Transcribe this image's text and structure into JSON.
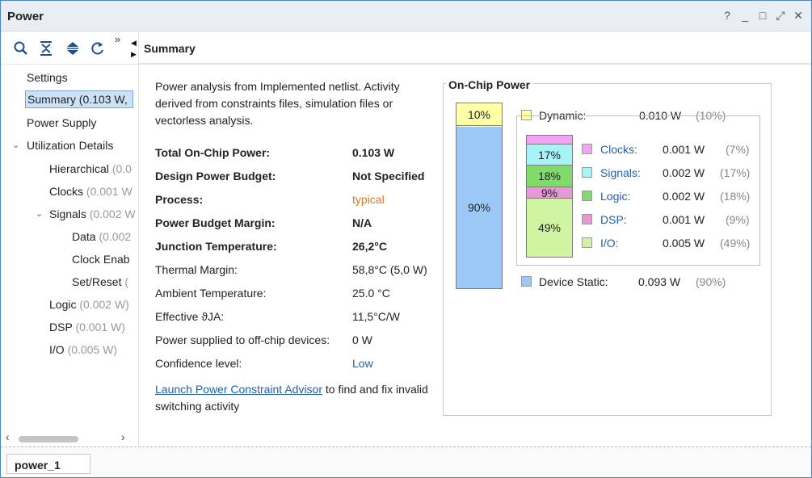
{
  "window": {
    "title": "Power",
    "controls": [
      "?",
      "_",
      "□",
      "⤢",
      "✕"
    ]
  },
  "toolbar": {
    "icons": [
      "search-icon",
      "collapse-all-icon",
      "expand-all-icon",
      "refresh-icon",
      "more-icon"
    ],
    "more": "»"
  },
  "panel": {
    "header": "Summary"
  },
  "tree": {
    "settings": "Settings",
    "summary": "Summary (0.103 W,",
    "power_supply": "Power Supply",
    "utilization": "Utilization Details",
    "hierarchical": "Hierarchical",
    "hierarchical_dim": "(0.0",
    "clocks": "Clocks",
    "clocks_dim": "(0.001 W",
    "signals": "Signals",
    "signals_dim": "(0.002 W",
    "data": "Data",
    "data_dim": "(0.002",
    "clock_enable": "Clock Enab",
    "set_reset": "Set/Reset",
    "set_reset_dim": "(",
    "logic": "Logic",
    "logic_dim": "(0.002 W)",
    "dsp": "DSP",
    "dsp_dim": "(0.001 W)",
    "io": "I/O",
    "io_dim": "(0.005 W)"
  },
  "summary": {
    "intro": "Power analysis from Implemented netlist. Activity derived from constraints files, simulation files or vectorless analysis.",
    "rows": [
      {
        "label": "Total On-Chip Power:",
        "value": "0.103 W"
      },
      {
        "label": "Design Power Budget:",
        "value": "Not Specified"
      },
      {
        "label": "Process:",
        "value": "typical"
      },
      {
        "label": "Power Budget Margin:",
        "value": "N/A"
      },
      {
        "label": "Junction Temperature:",
        "value": "26,2°C"
      },
      {
        "label": "Thermal Margin:",
        "value": "58,8°C (5,0 W)"
      },
      {
        "label": "Ambient Temperature:",
        "value": "25.0 °C"
      },
      {
        "label": "Effective ϑJA:",
        "value": "11,5°C/W"
      },
      {
        "label": "Power supplied to off-chip devices:",
        "value": "0 W"
      },
      {
        "label": "Confidence level:",
        "value": "Low"
      }
    ],
    "advisor_link": "Launch Power Constraint Advisor",
    "advisor_rest": " to find and fix invalid switching activity"
  },
  "onchip": {
    "title": "On-Chip Power",
    "dynamic": {
      "label": "Dynamic:",
      "value": "0.010 W",
      "pct": "(10%)",
      "bar_pct": "10%",
      "color": "#ffffa8"
    },
    "static": {
      "label": "Device Static:",
      "value": "0.093 W",
      "pct": "(90%)",
      "bar_pct": "90%",
      "color": "#9cc8f8"
    },
    "items": [
      {
        "label": "Clocks:",
        "value": "0.001 W",
        "pct": "(7%)",
        "bar_pct": "",
        "share": 7,
        "color": "#f2a3f4"
      },
      {
        "label": "Signals:",
        "value": "0.002 W",
        "pct": "(17%)",
        "bar_pct": "17%",
        "share": 17,
        "color": "#a6f4f8"
      },
      {
        "label": "Logic:",
        "value": "0.002 W",
        "pct": "(18%)",
        "bar_pct": "18%",
        "share": 18,
        "color": "#7fdc6a"
      },
      {
        "label": "DSP:",
        "value": "0.001 W",
        "pct": "(9%)",
        "bar_pct": "9%",
        "share": 9,
        "color": "#e49ad4"
      },
      {
        "label": "I/O:",
        "value": "0.005 W",
        "pct": "(49%)",
        "bar_pct": "49%",
        "share": 49,
        "color": "#cff5a2"
      }
    ]
  },
  "footer": {
    "tab": "power_1"
  },
  "colors": {
    "accent": "#1f5fad",
    "process": "#e07820",
    "selection": "#cde2f7"
  }
}
